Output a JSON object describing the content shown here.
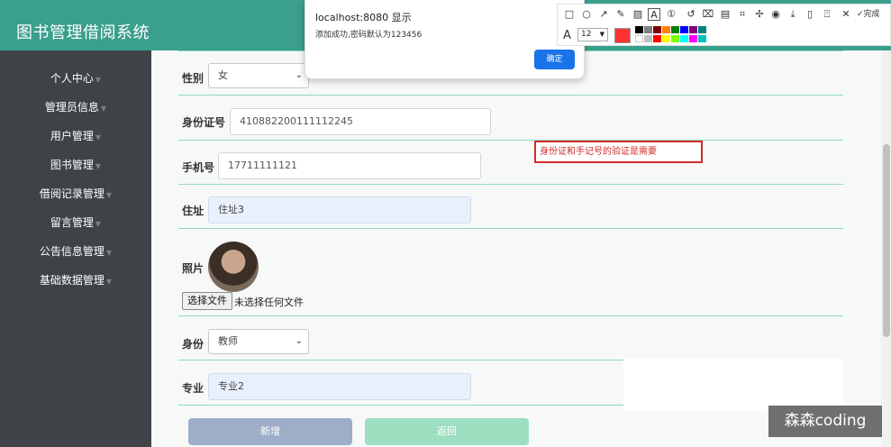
{
  "app": {
    "title": "图书管理借阅系统"
  },
  "header_icons": [
    "fullscreen-icon",
    "user-icon"
  ],
  "sidebar": {
    "items": [
      {
        "label": "个人中心",
        "chevron": "▼"
      },
      {
        "label": "管理员信息",
        "chevron": "▼"
      },
      {
        "label": "用户管理",
        "chevron": "▼"
      },
      {
        "label": "图书管理",
        "chevron": "▼"
      },
      {
        "label": "借阅记录管理",
        "chevron": "▼"
      },
      {
        "label": "留言管理",
        "chevron": "▼"
      },
      {
        "label": "公告信息管理",
        "chevron": "▼"
      },
      {
        "label": "基础数据管理",
        "chevron": "▼"
      }
    ]
  },
  "form": {
    "gender": {
      "label": "性别",
      "value": "女"
    },
    "id_card": {
      "label": "身份证号",
      "value": "410882200111112245"
    },
    "phone": {
      "label": "手机号",
      "value": "17711111121"
    },
    "address": {
      "label": "住址",
      "value": "住址3"
    },
    "photo": {
      "label": "照片",
      "choose_button": "选择文件",
      "no_file_text": "未选择任何文件"
    },
    "identity": {
      "label": "身份",
      "value": "教师"
    },
    "major": {
      "label": "专业",
      "value": "专业2"
    },
    "buttons": {
      "add": "新增",
      "back": "返回"
    }
  },
  "colors": {
    "header": "#3a9f8c",
    "sidebar": "#3f4347",
    "add_button": "#9eadc8",
    "back_button": "#9ddfc0",
    "annotation": "#d42b2b"
  },
  "dialog": {
    "title": "localhost:8080 显示",
    "message": "添加成功,密码默认为123456",
    "ok_label": "确定"
  },
  "screenshot_toolbar": {
    "font_size": "12",
    "done_label": "完成",
    "selected_color": "#ff3333",
    "palette": [
      "#000000",
      "#808080",
      "#800000",
      "#ff8000",
      "#008000",
      "#0000ff",
      "#800080",
      "#008080",
      "#ffffff",
      "#c0c0c0",
      "#ff0000",
      "#ffff00",
      "#80ff00",
      "#00ffff",
      "#ff00ff",
      "#00c0c0"
    ]
  },
  "annotation": {
    "text": "身份证和手记号的验证是需要"
  },
  "watermark": {
    "text": "森森coding"
  }
}
